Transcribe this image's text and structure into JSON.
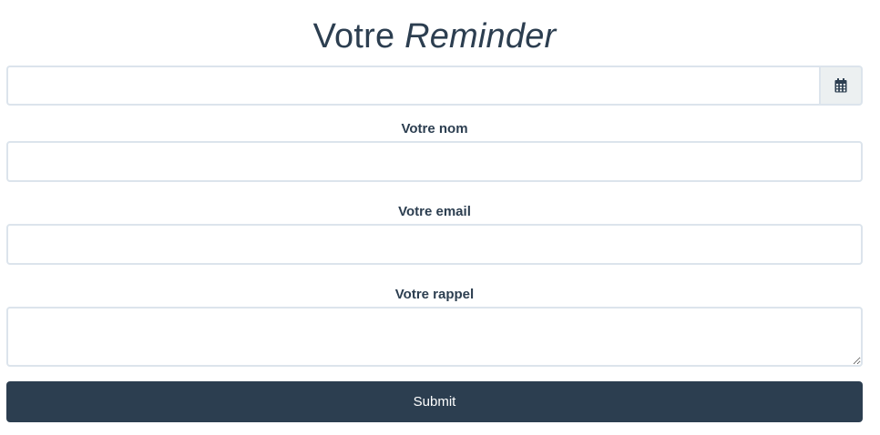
{
  "header": {
    "title_plain": "Votre",
    "title_italic": "Reminder"
  },
  "form": {
    "date": {
      "value": "",
      "icon": "calendar-icon"
    },
    "name": {
      "label": "Votre nom",
      "value": ""
    },
    "email": {
      "label": "Votre email",
      "value": ""
    },
    "reminder": {
      "label": "Votre rappel",
      "value": ""
    },
    "submit_label": "Submit"
  },
  "colors": {
    "primary": "#2c3e50",
    "input_border": "#dce4ec",
    "addon_bg": "#ecf0f1",
    "background": "#ffffff"
  }
}
